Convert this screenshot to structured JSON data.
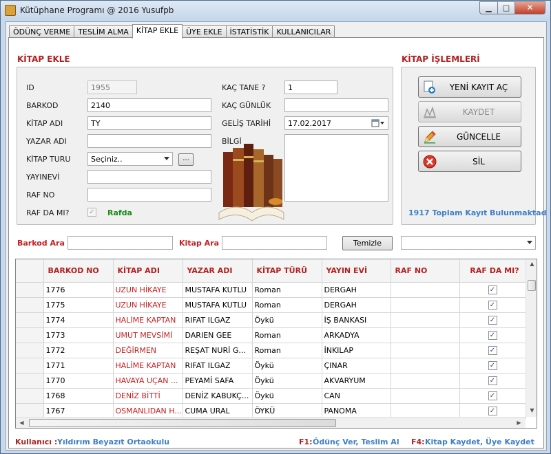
{
  "window": {
    "title": "Kütüphane Programı @ 2016 Yusufpb",
    "min": "▁",
    "max": "□",
    "close": "✕"
  },
  "tabs": [
    {
      "label": "ÖDÜNÇ VERME"
    },
    {
      "label": "TESLİM ALMA"
    },
    {
      "label": "KİTAP EKLE",
      "active": true
    },
    {
      "label": "ÜYE EKLE"
    },
    {
      "label": "İSTATİSTİK"
    },
    {
      "label": "KULLANICILAR"
    }
  ],
  "form": {
    "group_title": "KİTAP EKLE",
    "id_label": "ID",
    "id_value": "1955",
    "barkod_label": "BARKOD",
    "barkod_value": "2140",
    "kitap_adi_label": "KİTAP ADI",
    "kitap_adi_value": "TY",
    "yazar_adi_label": "YAZAR ADI",
    "yazar_adi_value": "",
    "kitap_turu_label": "KİTAP TURU",
    "kitap_turu_value": "Seçiniz..",
    "browse_label": "...",
    "yayinevi_label": "YAYINEVİ",
    "yayinevi_value": "",
    "raf_no_label": "RAF NO",
    "raf_no_value": "",
    "raf_da_mi_label": "RAF DA MI?",
    "raf_da_mi_checked": true,
    "raf_status": "Rafda",
    "kac_tane_label": "KAÇ TANE ?",
    "kac_tane_value": "1",
    "kac_gunluk_label": "KAÇ GÜNLÜK",
    "kac_gunluk_value": "",
    "gelis_tarihi_label": "GELİŞ TARİHİ",
    "gelis_tarihi_value": "17.02.2017",
    "bilgi_label": "BİLGİ",
    "bilgi_value": ""
  },
  "actions": {
    "group_title": "KİTAP İŞLEMLERİ",
    "new": "YENİ KAYIT AÇ",
    "save": "KAYDET",
    "update": "GÜNCELLE",
    "delete": "SİL",
    "count_text": "1917 Toplam Kayıt Bulunmaktad"
  },
  "search": {
    "barkod_label": "Barkod Ara",
    "barkod_value": "",
    "kitap_label": "Kitap Ara",
    "kitap_value": "",
    "clear": "Temizle",
    "filter_value": ""
  },
  "table": {
    "columns": [
      "BARKOD NO",
      "KİTAP ADI",
      "YAZAR ADI",
      "KİTAP TÜRÜ",
      "YAYIN EVİ",
      "RAF NO",
      "RAF DA MI?"
    ],
    "rows": [
      {
        "barkod": "1776",
        "kitap": "UZUN HİKAYE",
        "yazar": "MUSTAFA KUTLU",
        "tur": "Roman",
        "yayin": "DERGAH",
        "raf": "",
        "rafda": true
      },
      {
        "barkod": "1775",
        "kitap": "UZUN HİKAYE",
        "yazar": "MUSTAFA KUTLU",
        "tur": "Roman",
        "yayin": "DERGAH",
        "raf": "",
        "rafda": true
      },
      {
        "barkod": "1774",
        "kitap": "HALİME KAPTAN",
        "yazar": "RIFAT ILGAZ",
        "tur": "Öykü",
        "yayin": "İŞ BANKASI",
        "raf": "",
        "rafda": true
      },
      {
        "barkod": "1773",
        "kitap": "UMUT MEVSİMİ",
        "yazar": "DARIEN GEE",
        "tur": "Roman",
        "yayin": "ARKADYA",
        "raf": "",
        "rafda": true
      },
      {
        "barkod": "1772",
        "kitap": "DEĞİRMEN",
        "yazar": "REŞAT NURİ G...",
        "tur": "Roman",
        "yayin": "İNKILAP",
        "raf": "",
        "rafda": true
      },
      {
        "barkod": "1771",
        "kitap": "HALİME KAPTAN",
        "yazar": "RIFAT ILGAZ",
        "tur": "Öykü",
        "yayin": "ÇINAR",
        "raf": "",
        "rafda": true
      },
      {
        "barkod": "1770",
        "kitap": "HAVAYA UÇAN ...",
        "yazar": "PEYAMİ SAFA",
        "tur": "Öykü",
        "yayin": "AKVARYUM",
        "raf": "",
        "rafda": true
      },
      {
        "barkod": "1768",
        "kitap": "DENİZ BİTTİ",
        "yazar": "DENİZ KABUKÇ...",
        "tur": "Öykü",
        "yayin": "CAN",
        "raf": "",
        "rafda": true
      },
      {
        "barkod": "1767",
        "kitap": "OSMANLIDAN H...",
        "yazar": "CUMA URAL",
        "tur": "ÖYKÜ",
        "yayin": "PANOMA",
        "raf": "",
        "rafda": true
      }
    ]
  },
  "status": {
    "user_label": "Kullanıcı :",
    "user_value": "Yıldırım Beyazıt Ortaokulu",
    "f1_key": "F1:",
    "f1_text": "Ödünç Ver, Teslim Al",
    "f4_key": "F4:",
    "f4_text": "Kitap Kaydet, Üye Kaydet"
  },
  "colors": {
    "accent_red": "#b42020",
    "link_blue": "#3c7fc8",
    "rafda_green": "#1a8a1a"
  },
  "icons": [
    "app-book-icon",
    "new-record-icon",
    "save-disk-icon",
    "pencil-edit-icon",
    "delete-x-icon",
    "calendar-icon",
    "books-illustration"
  ]
}
